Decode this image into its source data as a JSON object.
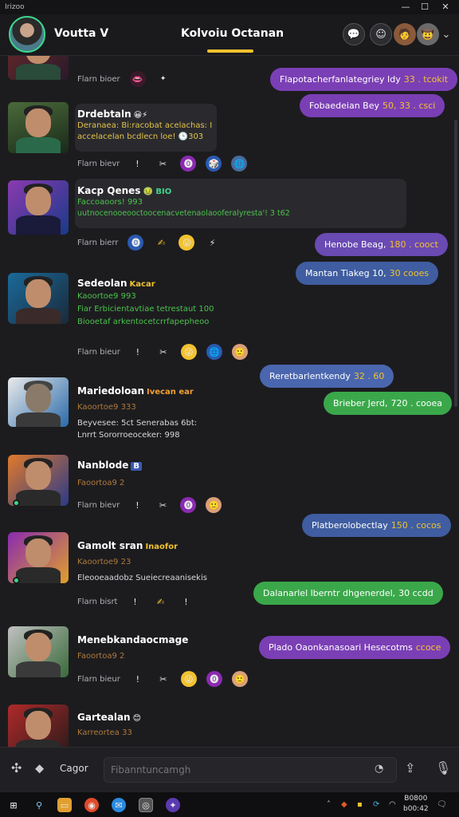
{
  "window": {
    "title": "Irizoo"
  },
  "header": {
    "user_name": "Voutta V",
    "channel_title": "Kolvoiu Octanan",
    "icons": [
      "chat-bubble-icon",
      "emoji-icon",
      "user-avatar",
      "user-avatar-alt",
      "chevron-down-icon"
    ]
  },
  "messages": [
    {
      "react_label": "Flarn bioer",
      "reactions": [
        "👄",
        "✦"
      ]
    },
    {
      "name": "Drdebtaln",
      "badge": "😀⚡",
      "lines": [
        "Deranaea: Bi:racobat acelachas: I",
        "accelacelan bcdlecn loe! 🕒303"
      ],
      "react_label": "Flarn bievr",
      "reactions": [
        "!",
        "✂",
        "⓿",
        "🎲",
        "🌐"
      ]
    },
    {
      "name": "Kacp Qenes",
      "badge": "🤢 BIO",
      "lines": [
        "Faccoaoors! 993",
        "uutnocenooeooctoocenacvetenaolaooferalyresta'! 3 t62"
      ],
      "react_label": "Flarn bierr",
      "reactions": [
        "⓿",
        "✍",
        "😜",
        "⚡"
      ]
    },
    {
      "name": "Sedeolan",
      "badge": "Kacar",
      "lines": [
        "Kaoortoe9 993",
        "Fiar Erbicientavtiae tetrestaut 100",
        "Biooetaf arkentocetcrrfapepheoo"
      ],
      "react_label": "Flarn bieur",
      "reactions": [
        "!",
        "✂",
        "😜",
        "🌐",
        "🙂"
      ]
    },
    {
      "name": "Mariedoloan",
      "badge": "Ivecan ear",
      "lines": [
        "Kaoortoe9 333",
        "Beyvesee: 5ct Senerabas 6bt:",
        "Lnrrt Sororroeoceker: 998"
      ],
      "react_label": "",
      "reactions": []
    },
    {
      "name": "Nanblode",
      "badge": "B",
      "lines": [
        "Faoortoa9 2"
      ],
      "react_label": "Flarn bievr",
      "reactions": [
        "!",
        "✂",
        "⓿",
        "🙂"
      ]
    },
    {
      "name": "Gamolt sran",
      "badge": "Inaofor",
      "lines": [
        "Kaoortoe9 23",
        "Eleooeaadobz Sueiecreaanisekis"
      ],
      "react_label": "Flarn bisrt",
      "reactions": [
        "!",
        "✍",
        "!"
      ]
    },
    {
      "name": "Menebkandaocmage",
      "badge": "",
      "lines": [
        "Faoortoa9 2"
      ],
      "react_label": "Flarn bieur",
      "reactions": [
        "!",
        "✂",
        "😜",
        "⓿",
        "🙂"
      ]
    },
    {
      "name": "Gartealan",
      "badge": "😊",
      "lines": [
        "Karreortea 33"
      ],
      "react_label": "",
      "reactions": []
    }
  ],
  "bubbles": [
    {
      "text": "Flapotacherfanlategriey Idy",
      "accent": "33 . tcokit"
    },
    {
      "text": "Fobaedeian Bey",
      "accent": "50, 33 . csci"
    },
    {
      "text": "Henobe Beag,",
      "accent": "180 . cooct"
    },
    {
      "text": "Mantan Tiakeg 10,",
      "accent": "30 cooes"
    },
    {
      "text": "Reretbarlentkendy",
      "accent": "32 . 60"
    },
    {
      "text": "Brieber Jerd,",
      "accent": "720 . cooea"
    },
    {
      "text": "Platberolobectlay",
      "accent": "150 . cocos"
    },
    {
      "text": "Dalanarlel lberntr dhgenerdel,",
      "accent": "30 ccdd"
    },
    {
      "text": "Plado Oaonkanasoari Hesecotms",
      "accent": "ccoce"
    }
  ],
  "composer": {
    "label": "Cagor",
    "placeholder": "Fibanntuncamgh"
  },
  "taskbar": {
    "time": "B0800",
    "date": "b00:42"
  },
  "colors": {
    "accent": "#f2c230",
    "online": "#3dd68c",
    "purple": "#7b3fb5",
    "green": "#3aa84a",
    "blue": "#4a66ae"
  }
}
